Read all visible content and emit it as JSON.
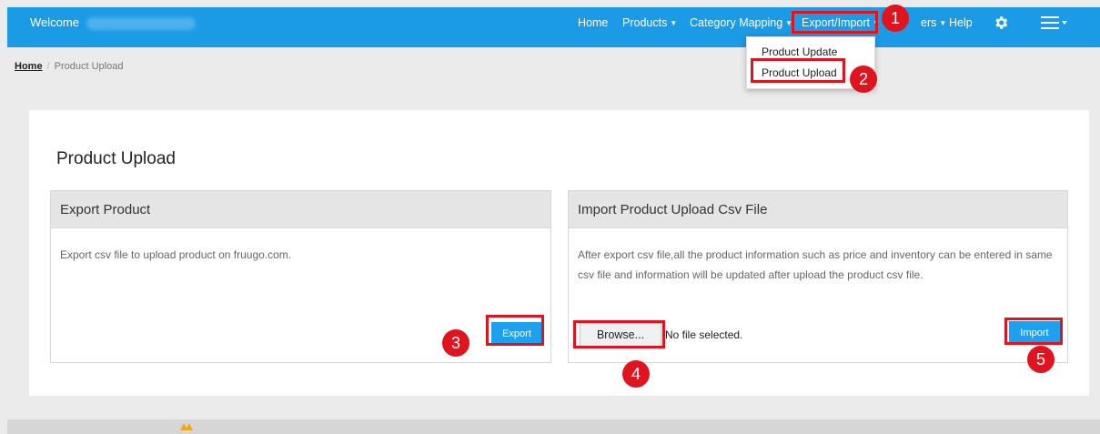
{
  "header": {
    "welcome": "Welcome",
    "nav": {
      "home": "Home",
      "products": "Products",
      "category_mapping": "Category Mapping",
      "export_import": "Export/Import",
      "orders": "ers",
      "help": "Help"
    },
    "icons": {
      "settings": "gear-icon",
      "menu": "hamburger-icon"
    }
  },
  "dropdown": {
    "items": [
      "Product Update",
      "Product Upload"
    ]
  },
  "breadcrumb": {
    "home": "Home",
    "sep": "/",
    "current": "Product Upload"
  },
  "page": {
    "title": "Product Upload"
  },
  "export_panel": {
    "title": "Export Product",
    "description": "Export csv file to upload product on fruugo.com.",
    "button": "Export"
  },
  "import_panel": {
    "title": "Import Product Upload Csv File",
    "description": "After export csv file,all the product information such as price and inventory can be entered in same csv file and information will be updated after upload the product csv file.",
    "browse": "Browse...",
    "file_status": "No file selected.",
    "button": "Import"
  },
  "annotations": [
    "1",
    "2",
    "3",
    "4",
    "5"
  ],
  "colors": {
    "navbar": "#1b9ae6",
    "button": "#1ba1f0",
    "highlight": "#e0141e"
  }
}
